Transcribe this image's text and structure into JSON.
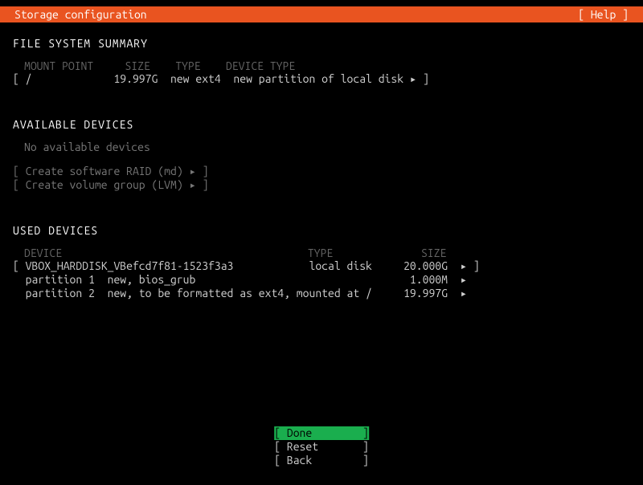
{
  "header": {
    "title": "Storage configuration",
    "help": "[ Help ]"
  },
  "file_system_summary": {
    "title": "FILE SYSTEM SUMMARY",
    "columns": {
      "mount_point": "MOUNT POINT",
      "size": "SIZE",
      "type": "TYPE",
      "device_type": "DEVICE TYPE"
    },
    "rows": [
      {
        "line": "[ /             19.997G  new ext4  new partition of local disk ▸ ]"
      }
    ]
  },
  "available_devices": {
    "title": "AVAILABLE DEVICES",
    "empty_message": "No available devices",
    "actions": {
      "raid": "[ Create software RAID (md) ▸ ]",
      "lvm": "[ Create volume group (LVM) ▸ ]"
    }
  },
  "used_devices": {
    "title": "USED DEVICES",
    "columns": {
      "device": "DEVICE",
      "type": "TYPE",
      "size": "SIZE"
    },
    "rows": [
      {
        "line": "[ VBOX_HARDDISK_VBefcd7f81-1523f3a3            local disk     20.000G  ▸ ]"
      },
      {
        "line": "  partition 1  new, bios_grub                                  1.000M  ▸  "
      },
      {
        "line": "  partition 2  new, to be formatted as ext4, mounted at /     19.997G  ▸  "
      }
    ]
  },
  "footer": {
    "done": "[ Done        ]",
    "reset": "[ Reset       ]",
    "back": "[ Back        ]"
  }
}
